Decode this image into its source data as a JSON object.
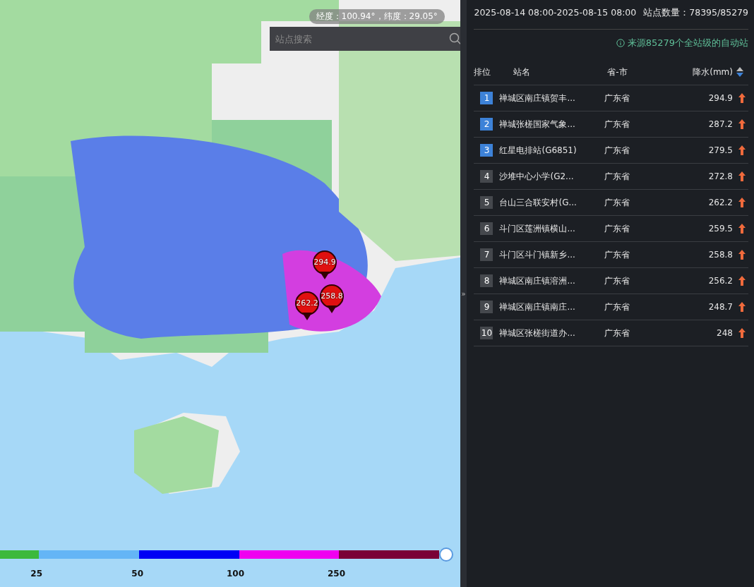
{
  "map": {
    "coordinates": "经度：100.94°，纬度：29.05°",
    "search": {
      "placeholder": "站点搜索"
    },
    "markers": [
      {
        "value": "294.9"
      },
      {
        "value": "262.2"
      },
      {
        "value": "258.8"
      }
    ],
    "legend": {
      "segments": [
        {
          "color": "#3cb93c",
          "label": "25"
        },
        {
          "color": "#64b5f6",
          "label": "50"
        },
        {
          "color": "#0000f5",
          "label": "100"
        },
        {
          "color": "#f000f0",
          "label": "250"
        },
        {
          "color": "#7a0036"
        }
      ]
    }
  },
  "panel": {
    "collapse_handle": "»",
    "period": "2025-08-14 08:00-2025-08-15 08:00",
    "station_count": "站点数量：78395/85279",
    "source_note": "来源85279个全站级的自动站",
    "table": {
      "columns": [
        "排位",
        "站名",
        "省-市",
        "降水(mm)"
      ],
      "rows": [
        {
          "rank": "1",
          "name": "禅城区南庄镇贺丰...",
          "province": "广东省",
          "value": "294.9",
          "top": true
        },
        {
          "rank": "2",
          "name": "禅城张槎国家气象...",
          "province": "广东省",
          "value": "287.2",
          "top": true
        },
        {
          "rank": "3",
          "name": "红星电排站(G6851)",
          "province": "广东省",
          "value": "279.5",
          "top": true
        },
        {
          "rank": "4",
          "name": "沙堆中心小学(G2...",
          "province": "广东省",
          "value": "272.8",
          "top": false
        },
        {
          "rank": "5",
          "name": "台山三合联安村(G...",
          "province": "广东省",
          "value": "262.2",
          "top": false
        },
        {
          "rank": "6",
          "name": "斗门区莲洲镇横山...",
          "province": "广东省",
          "value": "259.5",
          "top": false
        },
        {
          "rank": "7",
          "name": "斗门区斗门镇新乡...",
          "province": "广东省",
          "value": "258.8",
          "top": false
        },
        {
          "rank": "8",
          "name": "禅城区南庄镇溶洲...",
          "province": "广东省",
          "value": "256.2",
          "top": false
        },
        {
          "rank": "9",
          "name": "禅城区南庄镇南庄...",
          "province": "广东省",
          "value": "248.7",
          "top": false
        },
        {
          "rank": "10",
          "name": "禅城区张槎街道办...",
          "province": "广东省",
          "value": "248",
          "top": false
        }
      ]
    }
  }
}
